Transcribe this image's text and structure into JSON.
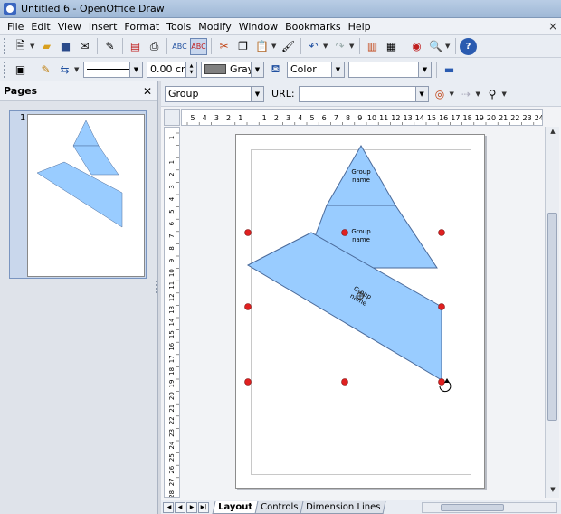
{
  "window": {
    "title": "Untitled 6 - OpenOffice Draw"
  },
  "menu": [
    "File",
    "Edit",
    "View",
    "Insert",
    "Format",
    "Tools",
    "Modify",
    "Window",
    "Bookmarks",
    "Help"
  ],
  "line_toolbar": {
    "line_width": "0.00 cm",
    "area_color": "Gray",
    "area_style": "Color",
    "area_fill": ""
  },
  "pages_pane": {
    "title": "Pages",
    "page_number": "1"
  },
  "object_bar": {
    "layer_select": "Group",
    "url_label": "URL:",
    "url_value": ""
  },
  "rulers": {
    "horizontal": [
      "5",
      "4",
      "3",
      "2",
      "1",
      "",
      "1",
      "2",
      "3",
      "4",
      "5",
      "6",
      "7",
      "8",
      "9",
      "10",
      "11",
      "12",
      "13",
      "14",
      "15",
      "16",
      "17",
      "18",
      "19",
      "20",
      "21",
      "22",
      "23",
      "24"
    ],
    "vertical": [
      "1",
      "",
      "1",
      "2",
      "3",
      "4",
      "5",
      "6",
      "7",
      "8",
      "9",
      "10",
      "11",
      "12",
      "13",
      "14",
      "15",
      "16",
      "17",
      "18",
      "19",
      "20",
      "21",
      "22",
      "23",
      "24",
      "25",
      "26",
      "27",
      "28",
      "29"
    ]
  },
  "drawing": {
    "shapes": [
      {
        "name": "top-triangle",
        "label_line1": "Group",
        "label_line2": "name"
      },
      {
        "name": "middle-trapezoid",
        "label_line1": "Group",
        "label_line2": "name"
      },
      {
        "name": "rotated-trapezoid",
        "label_line1": "Group",
        "label_line2": "name"
      }
    ],
    "fill_color": "#99ccff",
    "outline_color": "#4a6a9a",
    "handle_color": "#e02020"
  },
  "layer_tabs": [
    "Layout",
    "Controls",
    "Dimension Lines"
  ]
}
